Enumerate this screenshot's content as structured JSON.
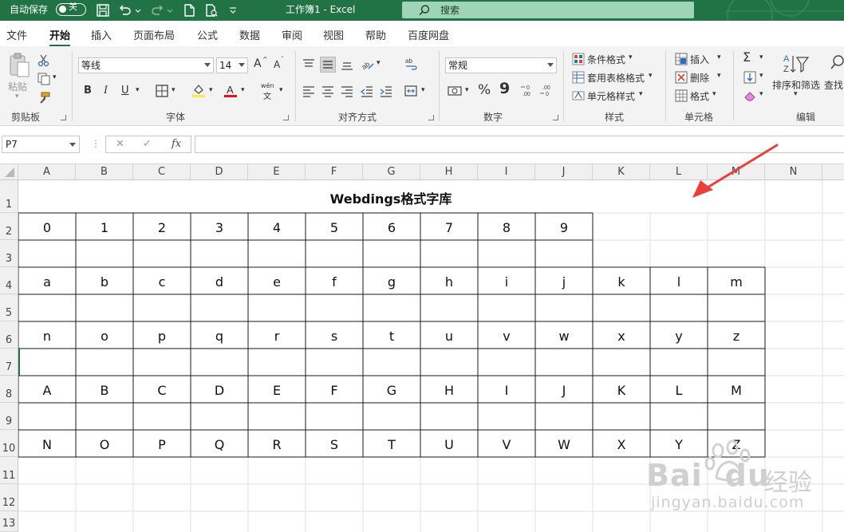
{
  "titlebar": {
    "autosave_label": "自动保存",
    "autosave_state": "关",
    "document_title": "工作簿1 - Excel",
    "search_placeholder": "搜索",
    "bg_color": "#217346"
  },
  "tabs": [
    "文件",
    "开始",
    "插入",
    "页面布局",
    "公式",
    "数据",
    "审阅",
    "视图",
    "帮助",
    "百度网盘"
  ],
  "active_tab": "开始",
  "ribbon": {
    "clipboard": {
      "paste_label": "粘贴",
      "group_label": "剪贴板"
    },
    "font": {
      "font_name": "等线",
      "font_size": "14",
      "group_label": "字体",
      "bold": "B",
      "italic": "I",
      "underline": "U",
      "grow": "A",
      "shrink": "A",
      "phonetic": "wén"
    },
    "alignment": {
      "group_label": "对齐方式"
    },
    "number": {
      "format": "常规",
      "percent": "%",
      "comma": "9",
      "group_label": "数字"
    },
    "styles": {
      "conditional": "条件格式",
      "table_format": "套用表格格式",
      "cell_style": "单元格样式",
      "group_label": "样式"
    },
    "cells": {
      "insert": "插入",
      "delete": "删除",
      "format": "格式",
      "group_label": "单元格"
    },
    "editing": {
      "sort_filter": "排序和筛选",
      "find": "查找",
      "group_label": "编辑",
      "sum": "Σ"
    }
  },
  "formula_bar": {
    "name_box": "P7",
    "cancel": "✕",
    "enter": "✓",
    "fx": "fx",
    "value": ""
  },
  "sheet": {
    "columns": [
      "A",
      "B",
      "C",
      "D",
      "E",
      "F",
      "G",
      "H",
      "I",
      "J",
      "K",
      "L",
      "M",
      "N"
    ],
    "rows": [
      "1",
      "2",
      "3",
      "4",
      "5",
      "6",
      "7",
      "8",
      "9",
      "10",
      "11",
      "12",
      "13"
    ],
    "title": "Webdings格式字库",
    "row2": [
      "0",
      "1",
      "2",
      "3",
      "4",
      "5",
      "6",
      "7",
      "8",
      "9"
    ],
    "row4": [
      "a",
      "b",
      "c",
      "d",
      "e",
      "f",
      "g",
      "h",
      "i",
      "j",
      "k",
      "l",
      "m"
    ],
    "row6": [
      "n",
      "o",
      "p",
      "q",
      "r",
      "s",
      "t",
      "u",
      "v",
      "w",
      "x",
      "y",
      "z"
    ],
    "row8": [
      "A",
      "B",
      "C",
      "D",
      "E",
      "F",
      "G",
      "H",
      "I",
      "J",
      "K",
      "L",
      "M"
    ],
    "row10": [
      "N",
      "O",
      "P",
      "Q",
      "R",
      "S",
      "T",
      "U",
      "V",
      "W",
      "X",
      "Y",
      "Z"
    ]
  },
  "watermark": {
    "brand": "Bai",
    "brand2": "du",
    "product": "经验",
    "url": "jingyan.baidu.com"
  },
  "accent_colors": {
    "excel_green": "#217346",
    "arrow_red": "#e8403a",
    "font_color_red": "#e81123",
    "highlight_yellow": "#ffeb3b"
  }
}
